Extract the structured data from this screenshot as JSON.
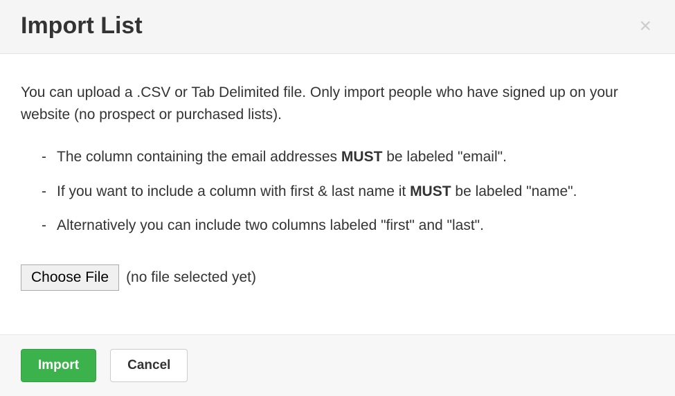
{
  "header": {
    "title": "Import List",
    "close_label": "×"
  },
  "body": {
    "intro": "You can upload a .CSV or Tab Delimited file. Only import people who have signed up on your website (no prospect or purchased lists).",
    "bullets": [
      {
        "pre": "The column containing the email addresses ",
        "strong": "MUST",
        "post": " be labeled \"email\"."
      },
      {
        "pre": "If you want to include a column with first & last name it ",
        "strong": "MUST",
        "post": " be labeled \"name\"."
      },
      {
        "pre": "Alternatively you can include two columns labeled \"first\" and \"last\".",
        "strong": "",
        "post": ""
      }
    ],
    "choose_file_label": "Choose File",
    "file_status": "(no file selected yet)"
  },
  "footer": {
    "import_label": "Import",
    "cancel_label": "Cancel"
  }
}
